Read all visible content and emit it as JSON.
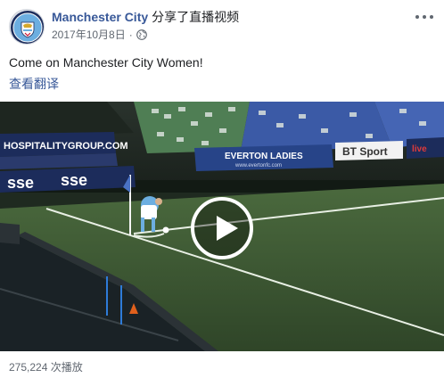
{
  "post": {
    "page_name": "Manchester City",
    "action": "分享了直播视频",
    "date": "2017年10月8日",
    "separator": "·",
    "privacy_icon": "globe-icon",
    "menu_icon": "more-horizontal-icon",
    "text": "Come on Manchester City Women!",
    "translate_label": "查看翻译",
    "view_count": "275,224 次播放"
  },
  "video": {
    "play_icon": "play-icon",
    "banner_left": "HOSPITALITYGROUP.COM",
    "sponsor_1": "sse",
    "sponsor_2": "sse",
    "banner_center": "EVERTON LADIES",
    "banner_center_url": "www.evertonfc.com",
    "banner_right": "BT Sport",
    "banner_far_right": "live"
  },
  "colors": {
    "brand_blue": "#385898",
    "secondary_text": "#606770",
    "pitch_green": "#3f5a35",
    "mancity_sky": "#6caee0"
  }
}
